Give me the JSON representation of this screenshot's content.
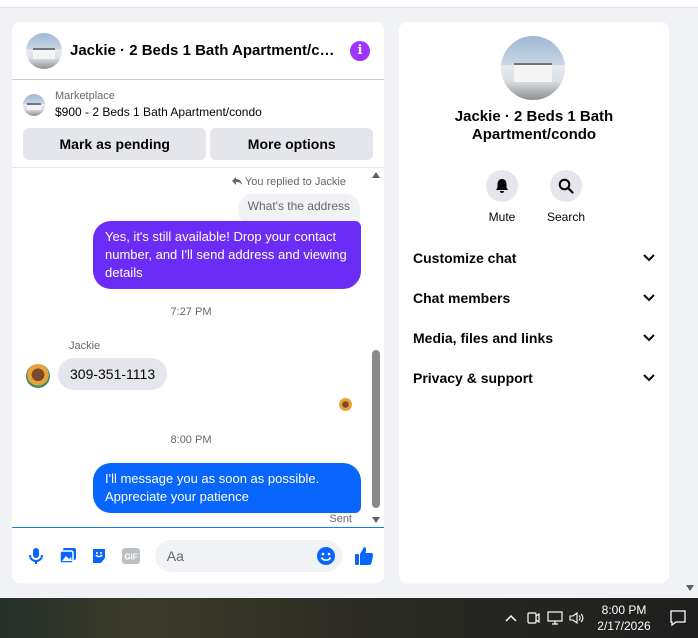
{
  "chat": {
    "title": "Jackie · 2 Beds 1 Bath Apartment/co...",
    "listing": {
      "category": "Marketplace",
      "price_title": "$900 - 2 Beds 1 Bath Apartment/condo",
      "mark_pending_label": "Mark as pending",
      "more_options_label": "More options"
    },
    "messages": {
      "replied_note": "You replied to Jackie",
      "quoted_text": "What's the address",
      "reply_text": "Yes, it's still available! Drop your contact number, and I'll send address and viewing details",
      "timestamp_1": "7:27 PM",
      "sender_name": "Jackie",
      "incoming_text": "309-351-1113",
      "timestamp_2": "8:00 PM",
      "outgoing_text": "I'll message you as soon as possible. Appreciate your patience",
      "status": "Sent"
    },
    "composer": {
      "placeholder": "Aa"
    },
    "colors": {
      "purple_bubble": "#6b2cf5",
      "blue_bubble": "#0866ff",
      "accent": "#0866ff",
      "info_icon": "#a033ff"
    }
  },
  "info_panel": {
    "name": "Jackie · 2 Beds 1 Bath Apartment/condo",
    "actions": [
      {
        "label": "Mute",
        "icon": "bell-icon"
      },
      {
        "label": "Search",
        "icon": "search-icon"
      }
    ],
    "sections": [
      {
        "label": "Customize chat"
      },
      {
        "label": "Chat members"
      },
      {
        "label": "Media, files and links"
      },
      {
        "label": "Privacy & support"
      }
    ]
  },
  "taskbar": {
    "time": "8:00 PM",
    "date": "2/17/2026"
  }
}
